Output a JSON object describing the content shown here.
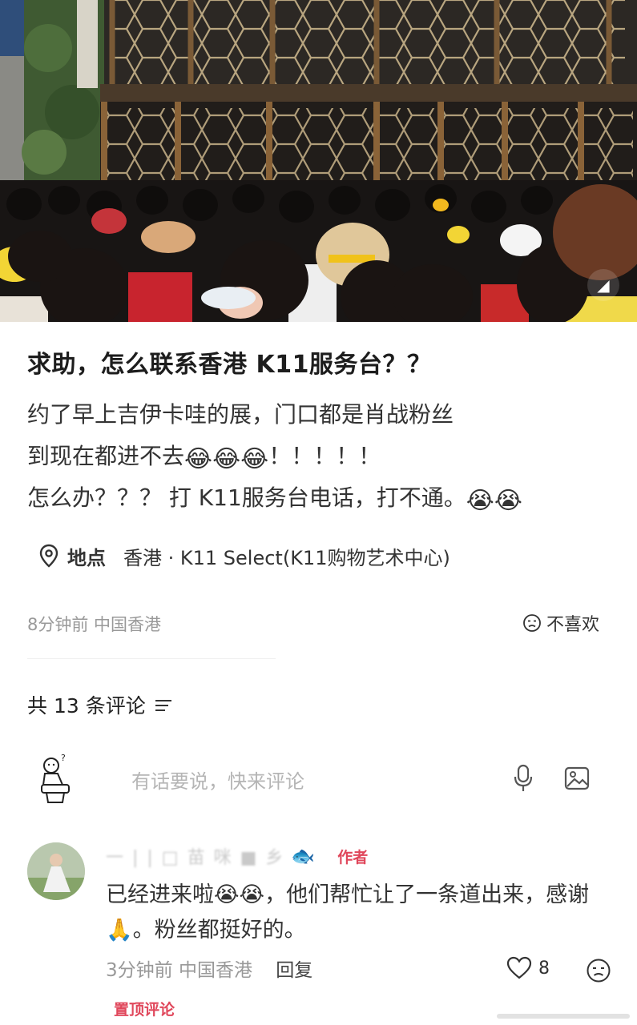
{
  "post": {
    "title": "求助，怎么联系香港 K11服务台？？",
    "body_lines": [
      "约了早上吉伊卡哇的展，门口都是肖战粉丝",
      "到现在都进不去",
      "怎么办？？？ 打 K11服务台电话，打不通。"
    ],
    "line2_emojis": "😂😂😂",
    "line2_tail": "！！！！！",
    "line3_emojis": "😭😭",
    "location_label": "地点",
    "location_value": "香港 · K11 Select(K11购物艺术中心)",
    "time_place": "8分钟前 中国香港",
    "dislike_label": "不喜欢"
  },
  "comments_header": {
    "count_text": "共 13 条评论"
  },
  "comment_input": {
    "placeholder": "有话要说，快来评论"
  },
  "comment": {
    "username": "一 | | □ 苗 咪     ■    乡",
    "user_badge_emoji": "🐟",
    "author_tag": "作者",
    "text": "已经进来啦😭😭，他们帮忙让了一条道出来，感谢🙏。粉丝都挺好的。",
    "time": "3分钟前",
    "place": "中国香港",
    "reply_label": "回复",
    "likes": "8",
    "pinned_label": "置顶评论"
  },
  "colors": {
    "accent_red": "#e0475b",
    "muted_text": "#999999",
    "body_text": "#333333"
  },
  "icons": [
    "location-pin-icon",
    "dislike-face-icon",
    "sort-filter-icon",
    "sticker-icon",
    "microphone-icon",
    "image-icon",
    "heart-icon",
    "video-badge-icon"
  ]
}
